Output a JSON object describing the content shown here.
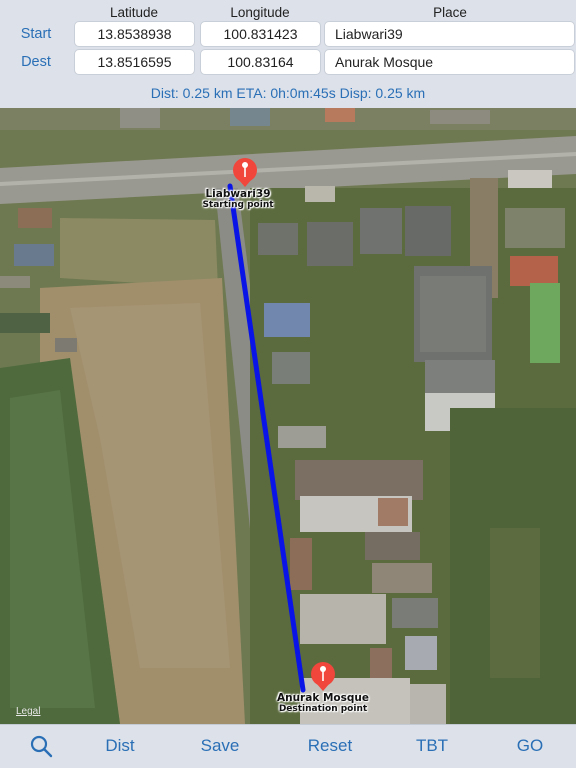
{
  "header": {
    "columns": {
      "latitude": "Latitude",
      "longitude": "Longitude",
      "place": "Place"
    },
    "start": {
      "label": "Start",
      "latitude": "13.8538938",
      "longitude": "100.831423",
      "place": "Liabwari39"
    },
    "dest": {
      "label": "Dest",
      "latitude": "13.8516595",
      "longitude": "100.83164",
      "place": "Anurak Mosque"
    },
    "summary": "Dist: 0.25 km ETA: 0h:0m:45s Disp: 0.25 km"
  },
  "map": {
    "start_pin": {
      "title": "Liabwari39",
      "subtitle": "Starting point"
    },
    "dest_pin": {
      "title": "Anurak Mosque",
      "subtitle": "Destination point"
    },
    "legal": "Legal",
    "route_color": "#0a14e6",
    "pin_color": "#f0463c"
  },
  "toolbar": {
    "search_icon": "magnifier-icon",
    "dist": "Dist",
    "save": "Save",
    "reset": "Reset",
    "tbt": "TBT",
    "go": "GO"
  },
  "colors": {
    "accent": "#2a6fb6"
  }
}
